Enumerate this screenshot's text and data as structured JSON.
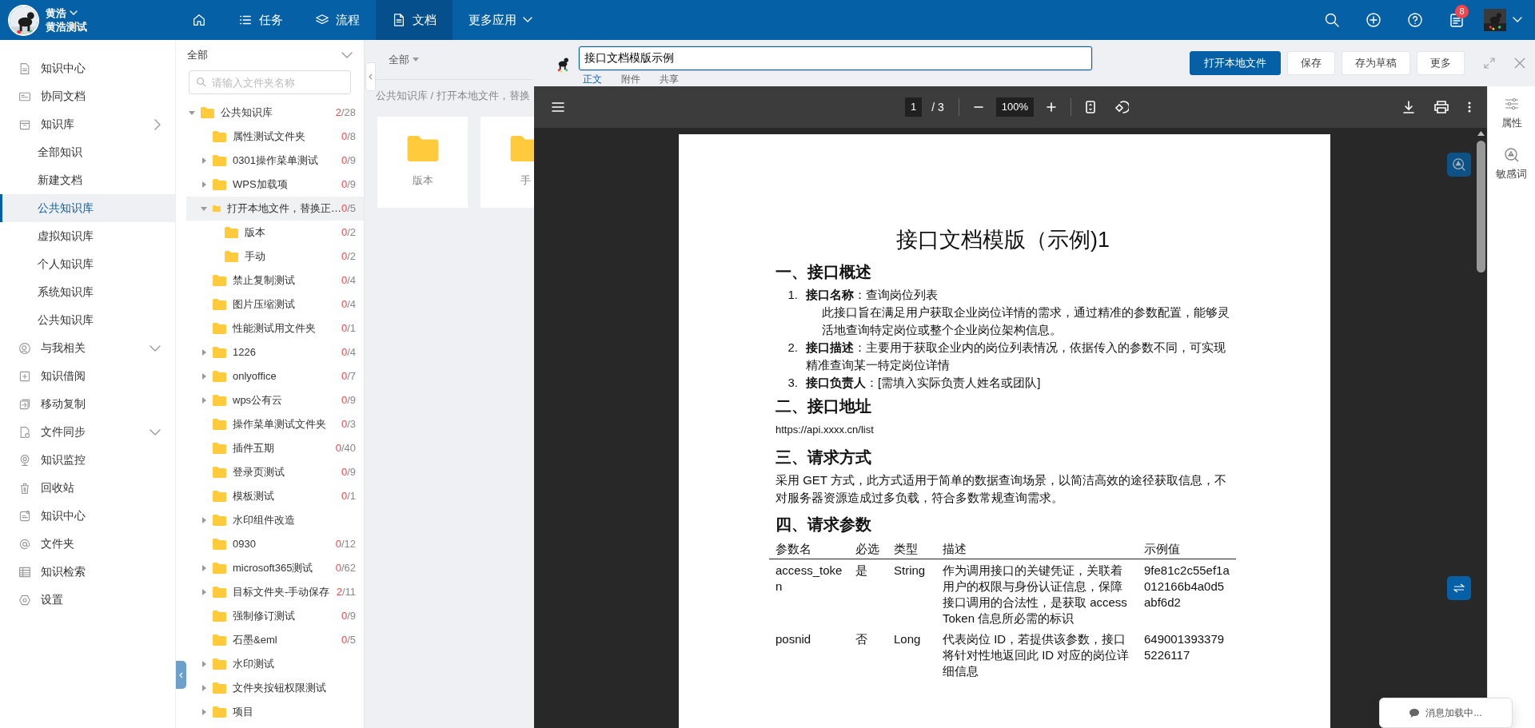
{
  "topbar": {
    "user": {
      "name": "黄浩",
      "org": "黄浩测试"
    },
    "nav": [
      {
        "kind": "home",
        "selected": false
      },
      {
        "kind": "tasks",
        "label": "任务",
        "selected": false
      },
      {
        "kind": "flow",
        "label": "流程",
        "selected": false
      },
      {
        "kind": "docs",
        "label": "文档",
        "selected": true
      },
      {
        "kind": "more",
        "label": "更多应用",
        "selected": false
      }
    ],
    "notifications": "8"
  },
  "sidebar": {
    "items": [
      {
        "label": "知识中心",
        "selected": false
      },
      {
        "label": "协同文档",
        "selected": false
      },
      {
        "label": "知识库",
        "selected": false,
        "expanded": true,
        "children": [
          {
            "label": "全部知识",
            "selected": false
          },
          {
            "label": "新建文档",
            "selected": false
          },
          {
            "label": "公共知识库",
            "selected": true
          },
          {
            "label": "虚拟知识库",
            "selected": false
          },
          {
            "label": "个人知识库",
            "selected": false
          },
          {
            "label": "系统知识库",
            "selected": false
          },
          {
            "label": "公共知识库",
            "selected": false
          }
        ]
      },
      {
        "label": "与我相关",
        "selected": false,
        "expanded": false
      },
      {
        "label": "知识借阅",
        "selected": false
      },
      {
        "label": "移动复制",
        "selected": false
      },
      {
        "label": "文件同步",
        "selected": false,
        "expanded": false
      },
      {
        "label": "知识监控",
        "selected": false
      },
      {
        "label": "回收站",
        "selected": false
      },
      {
        "label": "知识中心",
        "selected": false
      },
      {
        "label": "文件夹",
        "selected": false
      },
      {
        "label": "知识检索",
        "selected": false
      },
      {
        "label": "设置",
        "selected": false
      }
    ]
  },
  "tree": {
    "scope": "全部",
    "search": {
      "placeholder": "请输入文件夹名称"
    },
    "nodes": [
      {
        "label": "公共知识库",
        "kind": "branch",
        "expanded": true,
        "selected": false,
        "done": "2",
        "total": "/28",
        "children": [
          {
            "label": "属性测试文件夹",
            "kind": "leaf",
            "selected": false,
            "done": "0",
            "total": "/8"
          },
          {
            "label": "0301操作菜单测试",
            "kind": "branch",
            "expanded": false,
            "selected": false,
            "done": "0",
            "total": "/9"
          },
          {
            "label": "WPS加载项",
            "kind": "branch",
            "expanded": false,
            "selected": false,
            "done": "0",
            "total": "/9"
          },
          {
            "label": "打开本地文件，替换正…",
            "kind": "branch",
            "expanded": true,
            "selected": true,
            "done": "0",
            "total": "/5",
            "children": [
              {
                "label": "版本",
                "kind": "leaf",
                "selected": false,
                "done": "0",
                "total": "/2"
              },
              {
                "label": "手动",
                "kind": "leaf",
                "selected": false,
                "done": "0",
                "total": "/2"
              }
            ]
          },
          {
            "label": "禁止复制测试",
            "kind": "leaf",
            "selected": false,
            "done": "0",
            "total": "/4"
          },
          {
            "label": "图片压缩测试",
            "kind": "leaf",
            "selected": false,
            "done": "0",
            "total": "/4"
          },
          {
            "label": "性能测试用文件夹",
            "kind": "leaf",
            "selected": false,
            "done": "0",
            "total": "/1"
          },
          {
            "label": "1226",
            "kind": "branch",
            "expanded": false,
            "selected": false,
            "done": "0",
            "total": "/4"
          },
          {
            "label": "onlyoffice",
            "kind": "branch",
            "expanded": false,
            "selected": false,
            "done": "0",
            "total": "/7"
          },
          {
            "label": "wps公有云",
            "kind": "branch",
            "expanded": false,
            "selected": false,
            "done": "0",
            "total": "/9"
          },
          {
            "label": "操作菜单测试文件夹",
            "kind": "leaf",
            "selected": false,
            "done": "0",
            "total": "/3"
          },
          {
            "label": "插件五期",
            "kind": "leaf",
            "selected": false,
            "done": "0",
            "total": "/40"
          },
          {
            "label": "登录页测试",
            "kind": "leaf",
            "selected": false,
            "done": "0",
            "total": "/9"
          },
          {
            "label": "模板测试",
            "kind": "leaf",
            "selected": false,
            "done": "0",
            "total": "/1"
          },
          {
            "label": "水印组件改造",
            "kind": "branch",
            "expanded": false,
            "selected": false
          },
          {
            "label": "0930",
            "kind": "leaf",
            "selected": false,
            "done": "0",
            "total": "/12"
          },
          {
            "label": "microsoft365测试",
            "kind": "branch",
            "expanded": false,
            "selected": false,
            "done": "0",
            "total": "/62"
          },
          {
            "label": "目标文件夹-手动保存",
            "kind": "branch",
            "expanded": false,
            "selected": false,
            "done": "2",
            "total": "/11"
          },
          {
            "label": "强制修订测试",
            "kind": "leaf",
            "selected": false,
            "done": "0",
            "total": "/9"
          },
          {
            "label": "石墨&eml",
            "kind": "leaf",
            "selected": false,
            "done": "0",
            "total": "/5"
          },
          {
            "label": "水印测试",
            "kind": "branch",
            "expanded": false,
            "selected": false
          },
          {
            "label": "文件夹按钮权限测试",
            "kind": "branch",
            "expanded": false,
            "selected": false
          },
          {
            "label": "项目",
            "kind": "branch",
            "expanded": false,
            "selected": false
          }
        ]
      }
    ]
  },
  "content": {
    "filter": "全部",
    "breadcrumb": "公共知识库 / 打开本地文件，替换",
    "cards": [
      {
        "label": "版本"
      },
      {
        "label": "手"
      }
    ]
  },
  "document": {
    "title": "接口文档模版示例",
    "tabs": [
      {
        "label": "正文",
        "selected": true
      },
      {
        "label": "附件",
        "selected": false
      },
      {
        "label": "共享",
        "selected": false
      }
    ],
    "buttons": [
      {
        "label": "打开本地文件",
        "primary": true
      },
      {
        "label": "保存",
        "primary": false
      },
      {
        "label": "存为草稿",
        "primary": false
      },
      {
        "label": "更多",
        "primary": false
      }
    ],
    "viewer": {
      "page": "1",
      "pages": "/ 3",
      "zoom": "100%"
    },
    "page": {
      "title": "接口文档模版（示例)1",
      "blocks": [
        {
          "kind": "heading",
          "text": "一、接口概述"
        },
        {
          "kind": "list",
          "items": [
            {
              "number": "1.",
              "text": "**接口名称**：查询岗位列表",
              "note": "此接口旨在满足用户获取企业岗位详情的需求，通过精准的参数配置，能够灵活地查询特定岗位或整个企业岗位架构信息。"
            },
            {
              "number": "2.",
              "text": "**接口描述**：主要用于获取企业内的岗位列表情况，依据传入的参数不同，可实现精准查询某一特定岗位详情"
            },
            {
              "number": "3.",
              "text": "**接口负责人**：[需填入实际负责人姓名或团队]"
            }
          ]
        },
        {
          "kind": "heading",
          "text": "二、接口地址"
        },
        {
          "kind": "url",
          "text": "https://api.xxxx.cn/list"
        },
        {
          "kind": "heading",
          "text": "三、请求方式"
        },
        {
          "kind": "paragraph",
          "text": "采用 GET 方式，此方式适用于简单的数据查询场景，以简洁高效的途径获取信息，不对服务器资源造成过多负载，符合多数常规查询需求。"
        },
        {
          "kind": "heading",
          "text": "四、请求参数"
        },
        {
          "kind": "table",
          "columns": [
            "参数名",
            "必选",
            "类型",
            "描述",
            "示例值"
          ],
          "rows": [
            [
              "access_token",
              "是",
              "String",
              "作为调用接口的关键凭证，关联着用户的权限与身份认证信息，保障接口调用的合法性，是获取 accessToken 信息所必需的标识",
              "9fe81c2c55ef1a012166b4a0d5abf6d2"
            ],
            [
              "posnid",
              "否",
              "Long",
              "代表岗位 ID，若提供该参数，接口将针对性地返回此 ID 对应的岗位详细信息",
              "6490013933795226117"
            ]
          ]
        }
      ]
    },
    "side": [
      {
        "label": "属性"
      },
      {
        "label": "敏感词"
      }
    ]
  },
  "toast": "消息加载中..."
}
